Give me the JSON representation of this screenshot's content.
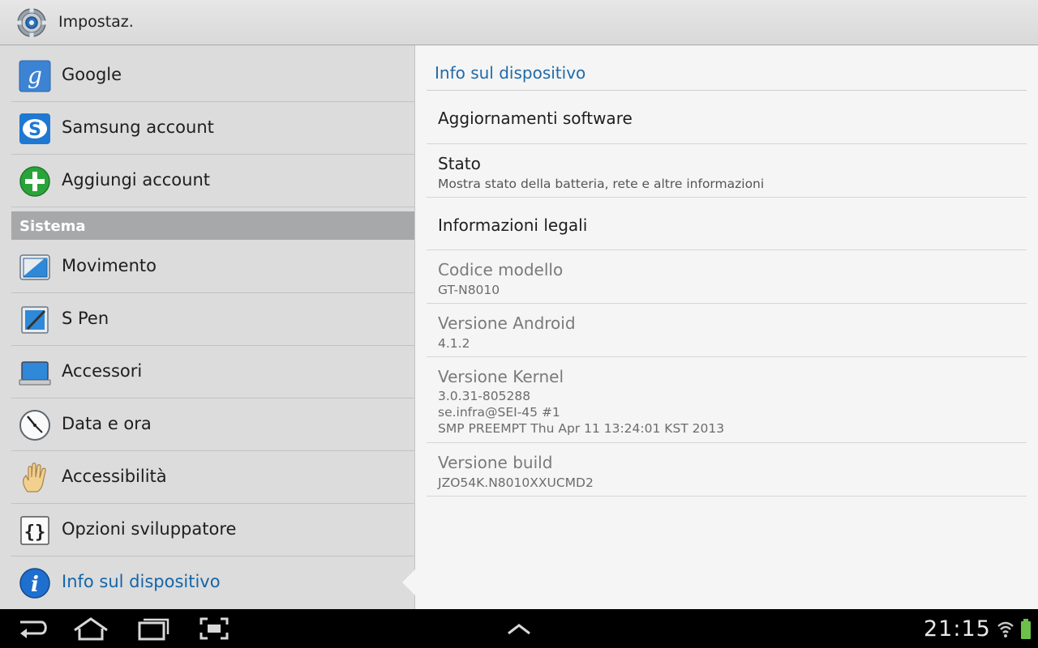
{
  "actionbar": {
    "title": "Impostaz."
  },
  "sidebar": {
    "items_top": [
      {
        "label": "Google",
        "icon": "google-icon"
      },
      {
        "label": "Samsung account",
        "icon": "samsung-account-icon"
      },
      {
        "label": "Aggiungi account",
        "icon": "add-account-icon"
      }
    ],
    "section": "Sistema",
    "items": [
      {
        "label": "Movimento",
        "icon": "motion-icon"
      },
      {
        "label": "S Pen",
        "icon": "s-pen-icon"
      },
      {
        "label": "Accessori",
        "icon": "accessories-icon"
      },
      {
        "label": "Data e ora",
        "icon": "clock-icon"
      },
      {
        "label": "Accessibilità",
        "icon": "hand-icon"
      },
      {
        "label": "Opzioni sviluppatore",
        "icon": "braces-icon"
      },
      {
        "label": "Info sul dispositivo",
        "icon": "info-icon",
        "selected": true
      }
    ]
  },
  "detail": {
    "header": "Info sul dispositivo",
    "items": [
      {
        "title": "Aggiornamenti software"
      },
      {
        "title": "Stato",
        "summary": "Mostra stato della batteria, rete e altre informazioni"
      },
      {
        "title": "Informazioni legali"
      },
      {
        "title": "Codice modello",
        "summary": "GT-N8010"
      },
      {
        "title": "Versione Android",
        "summary": "4.1.2"
      },
      {
        "title": "Versione Kernel",
        "summary_lines": [
          "3.0.31-805288",
          "se.infra@SEI-45 #1",
          "SMP PREEMPT Thu Apr 11 13:24:01 KST 2013"
        ]
      },
      {
        "title": "Versione build",
        "summary": "JZO54K.N8010XXUCMD2"
      }
    ]
  },
  "navbar": {
    "clock": "21:15",
    "buttons": [
      "back-icon",
      "home-icon",
      "recent-apps-icon",
      "screenshot-icon",
      "up-arrow-icon"
    ],
    "status_icons": [
      "wifi-icon",
      "battery-icon"
    ]
  },
  "colors": {
    "accent": "#1f6aa8",
    "section_header": "#a6a8aa",
    "left_bg": "#dcdcdc",
    "right_bg": "#f5f5f5"
  }
}
